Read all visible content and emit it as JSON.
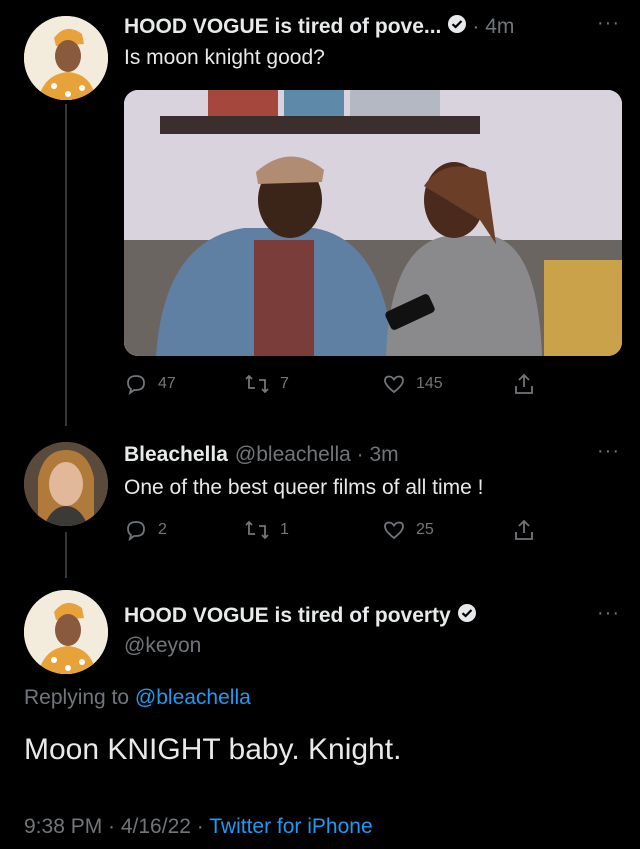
{
  "tweet1": {
    "display_name": "HOOD VOGUE is tired of pove...",
    "time": "· 4m",
    "text": "Is moon knight good?",
    "replies": "47",
    "retweets": "7",
    "likes": "145"
  },
  "tweet2": {
    "display_name": "Bleachella",
    "handle_time": "@bleachella · 3m",
    "text": "One of the best queer films of all time !",
    "replies": "2",
    "retweets": "1",
    "likes": "25"
  },
  "main_tweet": {
    "display_name": "HOOD VOGUE is tired of poverty",
    "handle": "@keyon",
    "replying_prefix": "Replying to",
    "replying_handle": "@bleachella",
    "text": "Moon KNIGHT baby. Knight.",
    "timestamp": "9:38 PM · 4/16/22 ·",
    "source": "Twitter for iPhone"
  },
  "icons": {
    "reply": "reply-icon",
    "retweet": "retweet-icon",
    "like": "heart-icon",
    "share": "share-icon",
    "verified": "verified-badge-icon",
    "more": "more-icon"
  },
  "colors": {
    "background": "#000000",
    "text": "#e7e9ea",
    "muted": "#71767b",
    "link": "#1d9bf0",
    "thread_line": "#333639"
  }
}
